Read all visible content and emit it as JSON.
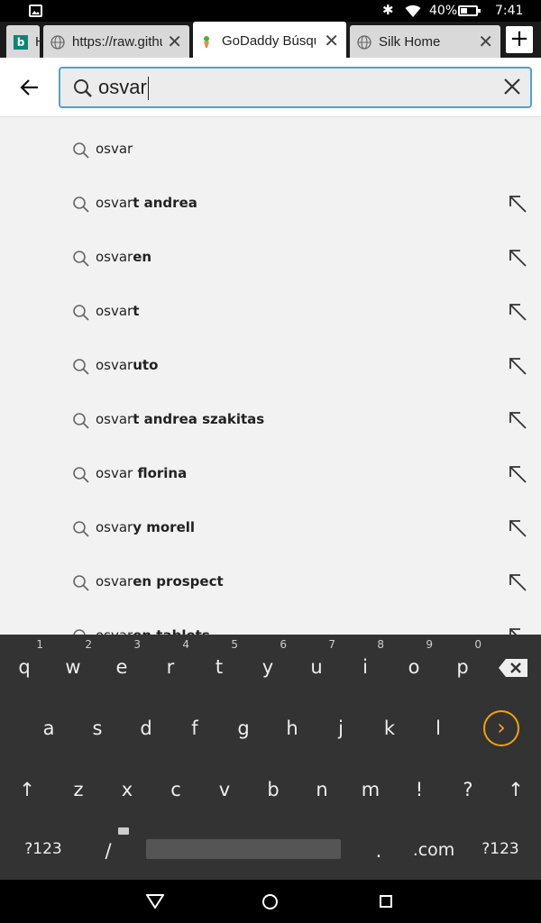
{
  "status_bar": {
    "battery": "40%",
    "time": "7:41"
  },
  "tabs": [
    {
      "title": "H",
      "favicon": "bing-icon",
      "active": false
    },
    {
      "title": "https://raw.githu",
      "favicon": "globe-icon",
      "active": false
    },
    {
      "title": "GoDaddy Búsque",
      "favicon": "godaddy-icon",
      "active": true
    },
    {
      "title": "Silk Home",
      "favicon": "globe-icon",
      "active": false
    }
  ],
  "tab_close_glyph": "✕",
  "new_tab_glyph": "+",
  "search": {
    "value": "osvar"
  },
  "suggestions": [
    {
      "prefix": "osvar",
      "suffix": "",
      "fillable": false
    },
    {
      "prefix": "osvar",
      "suffix": "t andrea",
      "fillable": true
    },
    {
      "prefix": "osvar",
      "suffix": "en",
      "fillable": true
    },
    {
      "prefix": "osvar",
      "suffix": "t",
      "fillable": true
    },
    {
      "prefix": "osvar",
      "suffix": "uto",
      "fillable": true
    },
    {
      "prefix": "osvar",
      "suffix": "t andrea szakitas",
      "fillable": true
    },
    {
      "prefix": "osvar",
      "suffix": " florina",
      "fillable": true
    },
    {
      "prefix": "osvar",
      "suffix": "y morell",
      "fillable": true
    },
    {
      "prefix": "osvar",
      "suffix": "en prospect",
      "fillable": true
    },
    {
      "prefix": "osvar",
      "suffix": "en tablets",
      "fillable": true
    }
  ],
  "keyboard": {
    "row1": [
      {
        "label": "q",
        "hint": "1"
      },
      {
        "label": "w",
        "hint": "2"
      },
      {
        "label": "e",
        "hint": "3"
      },
      {
        "label": "r",
        "hint": "4"
      },
      {
        "label": "t",
        "hint": "5"
      },
      {
        "label": "y",
        "hint": "6"
      },
      {
        "label": "u",
        "hint": "7"
      },
      {
        "label": "i",
        "hint": "8"
      },
      {
        "label": "o",
        "hint": "9"
      },
      {
        "label": "p",
        "hint": "0"
      }
    ],
    "row2": [
      "a",
      "s",
      "d",
      "f",
      "g",
      "h",
      "j",
      "k",
      "l"
    ],
    "row3": [
      "z",
      "x",
      "c",
      "v",
      "b",
      "n",
      "m",
      "!",
      "?"
    ],
    "shift": "↑",
    "symbols_left": "?123",
    "slash": "/",
    "period": ".",
    "dotcom": ".com",
    "symbols_right": "?123",
    "enter": "›"
  }
}
